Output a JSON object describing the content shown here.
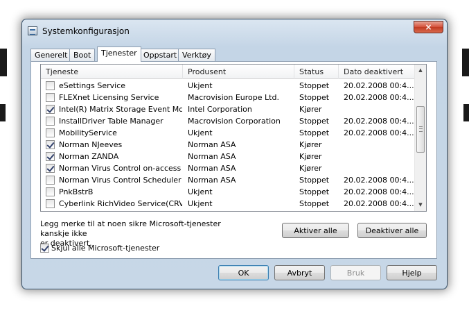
{
  "window": {
    "title": "Systemkonfigurasjon",
    "close_glyph": "×"
  },
  "tabs": [
    {
      "label": "Generelt",
      "active": false
    },
    {
      "label": "Boot",
      "active": false
    },
    {
      "label": "Tjenester",
      "active": true
    },
    {
      "label": "Oppstart",
      "active": false
    },
    {
      "label": "Verktøy",
      "active": false
    }
  ],
  "table": {
    "columns": [
      "Tjeneste",
      "Produsent",
      "Status",
      "Dato deaktivert"
    ],
    "rows": [
      {
        "checked": false,
        "name": "eSettings Service",
        "vendor": "Ukjent",
        "status": "Stoppet",
        "date": "20.02.2008 00:4..."
      },
      {
        "checked": false,
        "name": "FLEXnet Licensing Service",
        "vendor": "Macrovision Europe Ltd.",
        "status": "Stoppet",
        "date": "20.02.2008 00:4..."
      },
      {
        "checked": true,
        "name": "Intel(R) Matrix Storage Event Moni...",
        "vendor": "Intel Corporation",
        "status": "Kjører",
        "date": ""
      },
      {
        "checked": false,
        "name": "InstallDriver Table Manager",
        "vendor": "Macrovision Corporation",
        "status": "Stoppet",
        "date": "20.02.2008 00:4..."
      },
      {
        "checked": false,
        "name": "MobilityService",
        "vendor": "Ukjent",
        "status": "Stoppet",
        "date": "20.02.2008 00:4..."
      },
      {
        "checked": true,
        "name": "Norman NJeeves",
        "vendor": "Norman ASA",
        "status": "Kjører",
        "date": ""
      },
      {
        "checked": true,
        "name": "Norman ZANDA",
        "vendor": "Norman ASA",
        "status": "Kjører",
        "date": ""
      },
      {
        "checked": true,
        "name": "Norman Virus Control on-access co...",
        "vendor": "Norman ASA",
        "status": "Kjører",
        "date": ""
      },
      {
        "checked": false,
        "name": "Norman Virus Control Scheduler",
        "vendor": "Norman ASA",
        "status": "Stoppet",
        "date": "20.02.2008 00:4..."
      },
      {
        "checked": false,
        "name": "PnkBstrB",
        "vendor": "Ukjent",
        "status": "Stoppet",
        "date": "20.02.2008 00:4..."
      },
      {
        "checked": false,
        "name": "Cyberlink RichVideo Service(CRVS)",
        "vendor": "Ukjent",
        "status": "Stoppet",
        "date": "20.02.2008 00:4..."
      }
    ]
  },
  "scrollbar": {
    "up_glyph": "▲",
    "down_glyph": "▼"
  },
  "note": {
    "line1": "Legg merke til at noen sikre Microsoft-tjenester kanskje ikke",
    "line2": "er deaktivert."
  },
  "buttons": {
    "enable_all": "Aktiver alle",
    "disable_all": "Deaktiver alle",
    "ok": "OK",
    "cancel": "Avbryt",
    "apply": "Bruk",
    "help": "Hjelp"
  },
  "hide_microsoft": {
    "label": "Skjul alle Microsoft-tjenester",
    "checked": true
  }
}
